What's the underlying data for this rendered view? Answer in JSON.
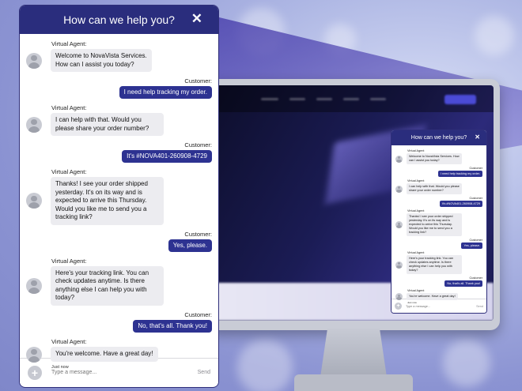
{
  "chat": {
    "title": "How can we help you?",
    "close_label": "✕",
    "agent_label": "Virtual Agent:",
    "customer_label": "Customer:",
    "messages": [
      {
        "from": "agent",
        "text": "Welcome to NovaVista Services.\nHow can I assist you today?"
      },
      {
        "from": "customer",
        "text": "I need help tracking my order."
      },
      {
        "from": "agent",
        "text": "I can help with that. Would you please share your order number?"
      },
      {
        "from": "customer",
        "text": "It's #NOVA401-260908-4729"
      },
      {
        "from": "agent",
        "text": "Thanks! I see your order shipped yesterday. It's on its way and is expected to arrive this Thursday. Would you like me to send you a tracking link?"
      },
      {
        "from": "customer",
        "text": "Yes, please."
      },
      {
        "from": "agent",
        "text": "Here's your tracking link. You can check updates anytime. Is there anything else I can help you with today?"
      },
      {
        "from": "customer",
        "text": "No, that's all. Thank you!"
      },
      {
        "from": "agent",
        "text": "You're welcome. Have a great day!"
      }
    ],
    "timestamp": "Just now",
    "input_placeholder": "Type a message...",
    "send_label": "Send",
    "plus_label": "+"
  },
  "small_chat": {
    "agent_label": "Virtual Agent",
    "customer_label": "Customer",
    "timestamp": "Just now"
  },
  "colors": {
    "header": "#2a2d7d",
    "customer_bubble": "#2d3291",
    "agent_bubble": "#ececf0"
  },
  "icons": {
    "close": "close-icon",
    "add": "plus-icon",
    "avatar": "agent-avatar-icon"
  }
}
